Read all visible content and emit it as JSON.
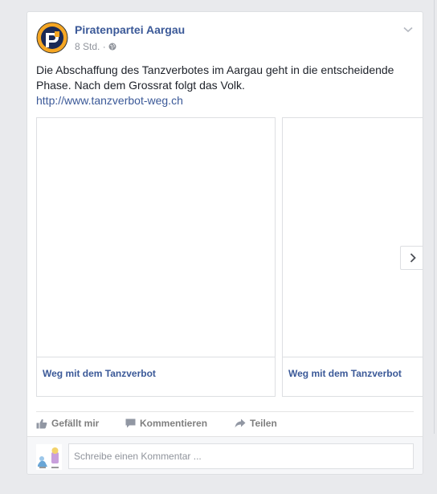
{
  "post": {
    "author": "Piratenpartei Aargau",
    "time": "8 Std. ·",
    "text": "Die Abschaffung des Tanzverbotes im Aargau geht in die entscheidende Phase. Nach dem Grossrat folgt das Volk.",
    "link": "http://www.tanzverbot-weg.ch",
    "attachments": [
      {
        "title": "Weg mit dem Tanzverbot"
      },
      {
        "title": "Weg mit dem Tanzverbot"
      }
    ]
  },
  "actions": {
    "like": "Gefällt mir",
    "comment": "Kommentieren",
    "share": "Teilen"
  },
  "comment_box": {
    "placeholder": "Schreibe einen Kommentar ..."
  },
  "colors": {
    "link": "#3b5998",
    "text": "#1d2129",
    "muted": "#90949c",
    "background": "#e9eaed"
  }
}
